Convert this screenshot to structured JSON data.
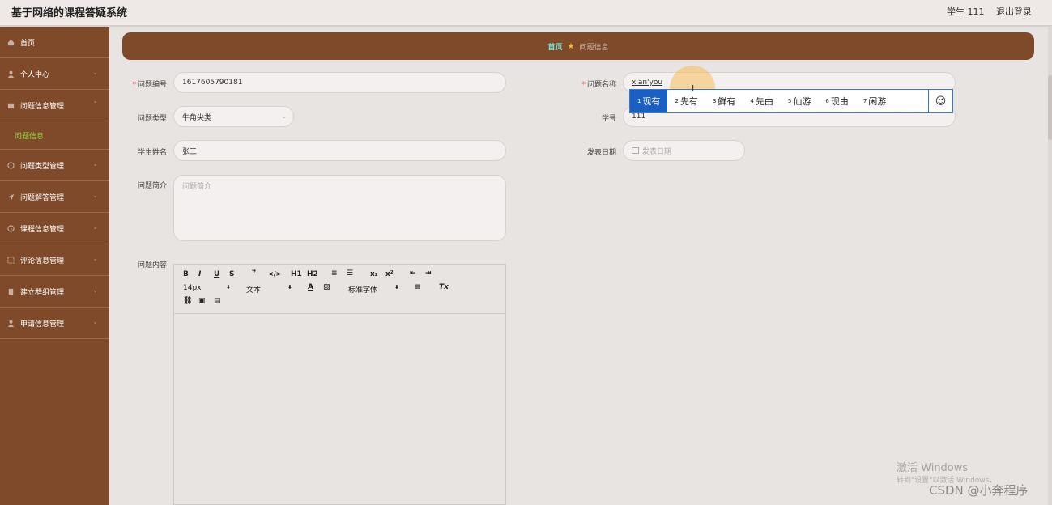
{
  "app": {
    "title": "基于网络的课程答疑系统",
    "user": "学生 111",
    "logout": "退出登录"
  },
  "sidebar": {
    "items": [
      {
        "label": "首页",
        "icon": "home-icon"
      },
      {
        "label": "个人中心",
        "icon": "user-icon"
      },
      {
        "label": "问题信息管理",
        "icon": "folder-icon",
        "expanded": true
      },
      {
        "label": "问题信息",
        "sub": true
      },
      {
        "label": "问题类型管理",
        "icon": "globe-icon"
      },
      {
        "label": "问题解答管理",
        "icon": "send-icon"
      },
      {
        "label": "课程信息管理",
        "icon": "clock-icon"
      },
      {
        "label": "评论信息管理",
        "icon": "frame-icon"
      },
      {
        "label": "建立群组管理",
        "icon": "building-icon"
      },
      {
        "label": "申请信息管理",
        "icon": "user-icon"
      }
    ]
  },
  "breadcrumb": {
    "home": "首页",
    "current": "问题信息"
  },
  "form": {
    "wentibianhao": {
      "label": "问题编号",
      "value": "1617605790181"
    },
    "wentimingcheng": {
      "label": "问题名称",
      "value": "xian'you"
    },
    "wentileixing": {
      "label": "问题类型",
      "value": "牛角尖类"
    },
    "xuehao": {
      "label": "学号",
      "value": "111"
    },
    "xueshengxingming": {
      "label": "学生姓名",
      "value": "张三"
    },
    "fabiaoriqi": {
      "label": "发表日期",
      "placeholder": "发表日期"
    },
    "wentijianjie": {
      "label": "问题简介",
      "placeholder": "问题简介"
    },
    "wentineirong": {
      "label": "问题内容"
    }
  },
  "editor": {
    "row1": [
      "B",
      "I",
      "U",
      "S",
      "❞",
      "</>",
      "H1",
      "H2",
      "≡",
      "☰",
      "x₂",
      "x²",
      "⇤",
      "⇥"
    ],
    "fontsize": "14px",
    "format": "文本",
    "font": "标准字体",
    "align": "≡",
    "clear": "Tx"
  },
  "ime": {
    "candidates": [
      {
        "n": "1",
        "text": "现有"
      },
      {
        "n": "2",
        "text": "先有"
      },
      {
        "n": "3",
        "text": "鲜有"
      },
      {
        "n": "4",
        "text": "先由"
      },
      {
        "n": "5",
        "text": "仙游"
      },
      {
        "n": "6",
        "text": "现由"
      },
      {
        "n": "7",
        "text": "闲游"
      }
    ],
    "emoji": "☺"
  },
  "watermark": {
    "line1": "激活 Windows",
    "line2": "转到\"设置\"以激活 Windows。",
    "csdn": "CSDN @小奔程序"
  },
  "colors": {
    "sidebar": "#7e4a2a",
    "accent_active": "#9ee04a",
    "breadcrumb_home": "#6fe3d0",
    "ime_select": "#1a5fc4"
  }
}
